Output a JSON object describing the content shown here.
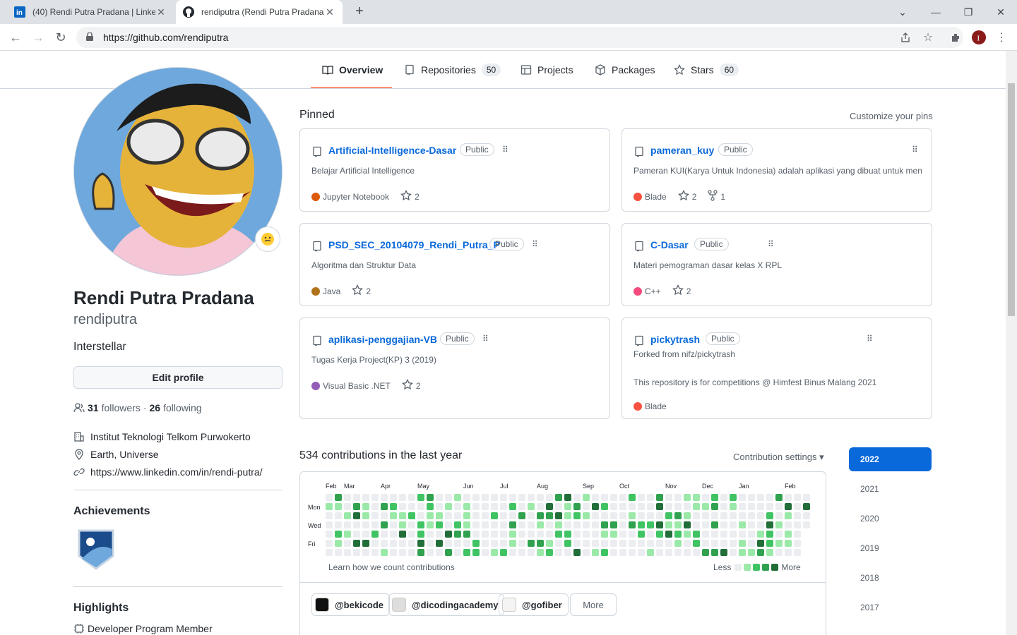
{
  "browser": {
    "tabs": [
      {
        "title": "(40) Rendi Putra Pradana | LinkedIn",
        "active": false
      },
      {
        "title": "rendiputra (Rendi Putra Pradana)",
        "active": true
      }
    ],
    "url": "https://github.com/rendiputra"
  },
  "nav": {
    "tabs": [
      {
        "label": "Overview",
        "count": ""
      },
      {
        "label": "Repositories",
        "count": "50"
      },
      {
        "label": "Projects",
        "count": ""
      },
      {
        "label": "Packages",
        "count": ""
      },
      {
        "label": "Stars",
        "count": "60"
      }
    ]
  },
  "profile": {
    "full_name": "Rendi Putra Pradana",
    "username": "rendiputra",
    "bio": "Interstellar",
    "edit_label": "Edit profile",
    "followers": "31",
    "followers_label": "followers",
    "following": "26",
    "following_label": "following",
    "separator": "·",
    "organization": "Institut Teknologi Telkom Purwokerto",
    "location": "Earth, Universe",
    "website": "https://www.linkedin.com/in/rendi-putra/",
    "achievements_title": "Achievements",
    "highlights_title": "Highlights",
    "highlight_item": "Developer Program Member"
  },
  "pinned": {
    "title": "Pinned",
    "customize": "Customize your pins",
    "public_label": "Public",
    "repos": [
      {
        "name": "Artificial-Intelligence-Dasar",
        "desc": "Belajar Artificial Intelligence",
        "lang": "Jupyter Notebook",
        "color": "#DA5B0B",
        "stars": "2",
        "forks": "",
        "forked_from": ""
      },
      {
        "name": "pameran_kuy",
        "desc": "Pameran KUI(Karya Untuk Indonesia) adalah aplikasi yang dibuat untuk menc",
        "lang": "Blade",
        "color": "#f7523f",
        "stars": "2",
        "forks": "1",
        "forked_from": ""
      },
      {
        "name": "PSD_SEC_20104079_Rendi_Putra_P",
        "desc": "Algoritma dan Struktur Data",
        "lang": "Java",
        "color": "#b07219",
        "stars": "2",
        "forks": "",
        "forked_from": ""
      },
      {
        "name": "C-Dasar",
        "desc": "Materi pemograman dasar kelas X RPL",
        "lang": "C++",
        "color": "#f34b7d",
        "stars": "2",
        "forks": "",
        "forked_from": ""
      },
      {
        "name": "aplikasi-penggajian-VB",
        "desc": "Tugas Kerja Project(KP) 3 (2019)",
        "lang": "Visual Basic .NET",
        "color": "#945db7",
        "stars": "2",
        "forks": "",
        "forked_from": ""
      },
      {
        "name": "pickytrash",
        "desc": "This repository is for competitions @ Himfest Binus Malang 2021",
        "lang": "Blade",
        "color": "#f7523f",
        "stars": "",
        "forks": "",
        "forked_from": "Forked from nifz/pickytrash"
      }
    ]
  },
  "contributions": {
    "heading": "534 contributions in the last year",
    "settings": "Contribution settings ▾",
    "months": [
      "Feb",
      "Mar",
      "Apr",
      "May",
      "Jun",
      "Jul",
      "Aug",
      "Sep",
      "Oct",
      "Nov",
      "Dec",
      "Jan",
      "Feb"
    ],
    "days": [
      "Mon",
      "Wed",
      "Fri"
    ],
    "learn": "Learn how we count contributions",
    "less": "Less",
    "more": "More",
    "levels": [
      "#ebedf0",
      "#9be9a8",
      "#40c463",
      "#30a14e",
      "#216e39"
    ],
    "orgs": [
      "@bekicode",
      "@dicodingacademy",
      "@gofiber"
    ],
    "more_btn": "More",
    "years": [
      "2022",
      "2021",
      "2020",
      "2019",
      "2018",
      "2017"
    ]
  }
}
